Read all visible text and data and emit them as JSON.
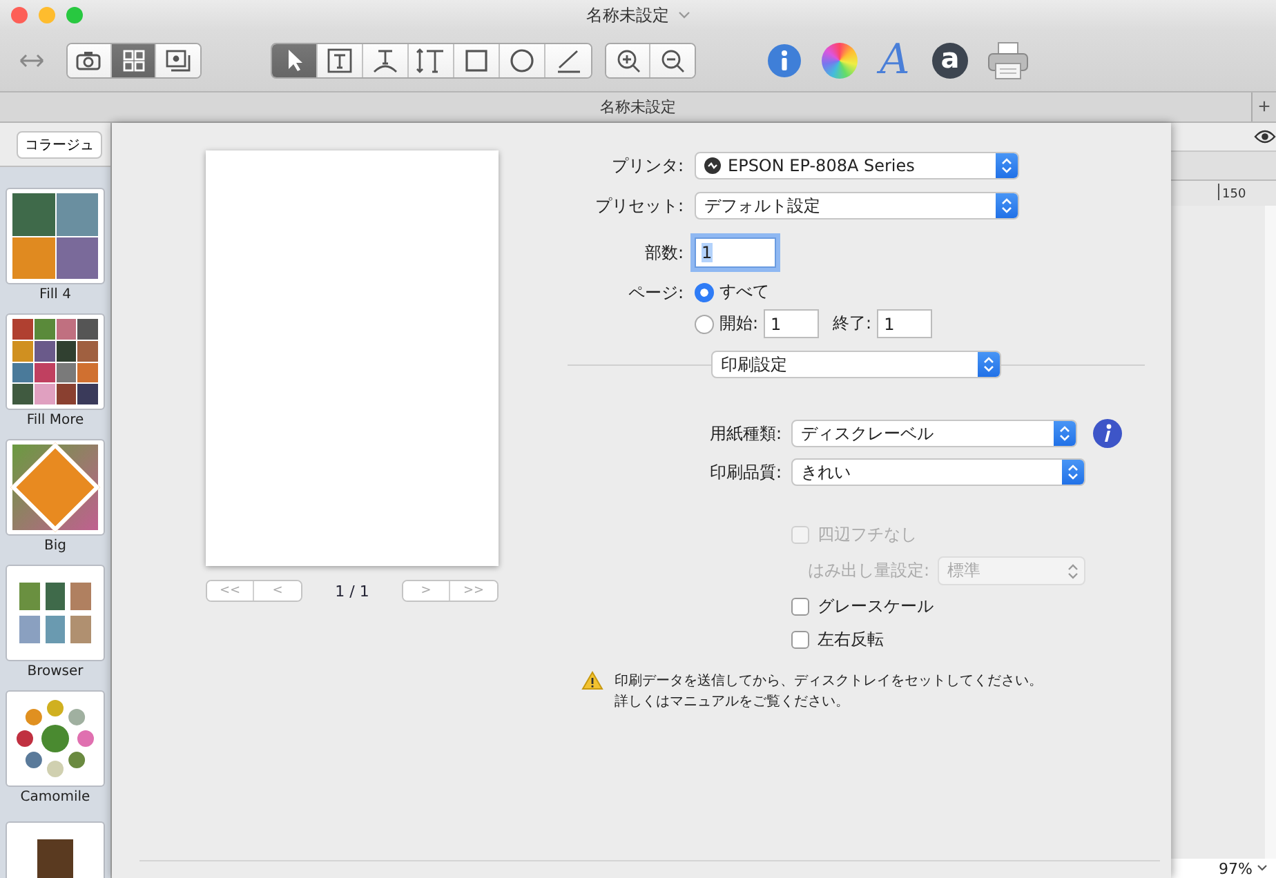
{
  "window": {
    "title": "名称未設定"
  },
  "toolbar": {
    "view_buttons": [
      {
        "kind": "camera",
        "selected": false
      },
      {
        "kind": "grid",
        "selected": true
      },
      {
        "kind": "photo",
        "selected": false
      }
    ],
    "tools": [
      {
        "kind": "pointer",
        "selected": true
      },
      {
        "kind": "textbox",
        "selected": false
      },
      {
        "kind": "arctext",
        "selected": false
      },
      {
        "kind": "verticaltext",
        "selected": false
      },
      {
        "kind": "rect",
        "selected": false
      },
      {
        "kind": "circle",
        "selected": false
      },
      {
        "kind": "line",
        "selected": false
      }
    ],
    "zoom_buttons": [
      {
        "kind": "zoomin"
      },
      {
        "kind": "zoomout"
      }
    ],
    "font_glyph": "A",
    "store_glyph": "a"
  },
  "tab_bar": {
    "title": "名称未設定",
    "add": "+"
  },
  "sidebar": {
    "category_button": "コラージュ",
    "templates": [
      {
        "name": "Fill 4",
        "kind": "grid4"
      },
      {
        "name": "Fill More",
        "kind": "grid16"
      },
      {
        "name": "Big",
        "kind": "diamond"
      },
      {
        "name": "Browser",
        "kind": "browser"
      },
      {
        "name": "Camomile",
        "kind": "circles"
      }
    ],
    "more_below": true
  },
  "print_dialog": {
    "preview": {
      "page_indicator": "1 / 1",
      "first": "<<",
      "prev": "<",
      "next": ">",
      "last": ">>"
    },
    "printer": {
      "label": "プリンタ:",
      "value": "EPSON EP-808A Series"
    },
    "preset": {
      "label": "プリセット:",
      "value": "デフォルト設定"
    },
    "copies": {
      "label": "部数:",
      "value": "1",
      "focused": true
    },
    "pages": {
      "label": "ページ:",
      "options": [
        {
          "label": "すべて",
          "selected": true
        },
        {
          "label": "開始:",
          "selected": false
        }
      ],
      "from": "1",
      "to_label": "終了:",
      "to": "1"
    },
    "section_popup": "印刷設定",
    "paper_type": {
      "label": "用紙種類:",
      "value": "ディスクレーベル"
    },
    "quality": {
      "label": "印刷品質:",
      "value": "きれい"
    },
    "options": [
      {
        "kind": "checkbox",
        "label": "四辺フチなし",
        "checked": false,
        "disabled": true
      },
      {
        "kind": "popup",
        "label": "はみ出し量設定:",
        "value": "標準",
        "disabled": true
      },
      {
        "kind": "checkbox",
        "label": "グレースケール",
        "checked": false,
        "disabled": false
      },
      {
        "kind": "checkbox",
        "label": "左右反転",
        "checked": false,
        "disabled": false
      }
    ],
    "warning": [
      "印刷データを送信してから、ディスクトレイをセットしてください。",
      "詳しくはマニュアルをご覧ください。"
    ]
  },
  "canvas": {
    "ruler_label": "150",
    "zoom": "97%"
  }
}
